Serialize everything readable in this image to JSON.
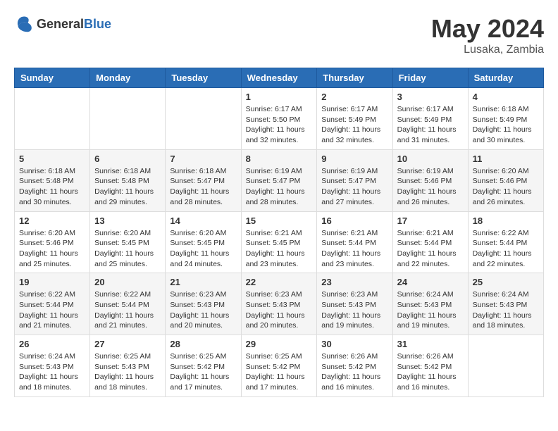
{
  "header": {
    "logo_general": "General",
    "logo_blue": "Blue",
    "title": "May 2024",
    "location": "Lusaka, Zambia"
  },
  "weekdays": [
    "Sunday",
    "Monday",
    "Tuesday",
    "Wednesday",
    "Thursday",
    "Friday",
    "Saturday"
  ],
  "weeks": [
    [
      {
        "day": "",
        "info": ""
      },
      {
        "day": "",
        "info": ""
      },
      {
        "day": "",
        "info": ""
      },
      {
        "day": "1",
        "info": "Sunrise: 6:17 AM\nSunset: 5:50 PM\nDaylight: 11 hours and 32 minutes."
      },
      {
        "day": "2",
        "info": "Sunrise: 6:17 AM\nSunset: 5:49 PM\nDaylight: 11 hours and 32 minutes."
      },
      {
        "day": "3",
        "info": "Sunrise: 6:17 AM\nSunset: 5:49 PM\nDaylight: 11 hours and 31 minutes."
      },
      {
        "day": "4",
        "info": "Sunrise: 6:18 AM\nSunset: 5:49 PM\nDaylight: 11 hours and 30 minutes."
      }
    ],
    [
      {
        "day": "5",
        "info": "Sunrise: 6:18 AM\nSunset: 5:48 PM\nDaylight: 11 hours and 30 minutes."
      },
      {
        "day": "6",
        "info": "Sunrise: 6:18 AM\nSunset: 5:48 PM\nDaylight: 11 hours and 29 minutes."
      },
      {
        "day": "7",
        "info": "Sunrise: 6:18 AM\nSunset: 5:47 PM\nDaylight: 11 hours and 28 minutes."
      },
      {
        "day": "8",
        "info": "Sunrise: 6:19 AM\nSunset: 5:47 PM\nDaylight: 11 hours and 28 minutes."
      },
      {
        "day": "9",
        "info": "Sunrise: 6:19 AM\nSunset: 5:47 PM\nDaylight: 11 hours and 27 minutes."
      },
      {
        "day": "10",
        "info": "Sunrise: 6:19 AM\nSunset: 5:46 PM\nDaylight: 11 hours and 26 minutes."
      },
      {
        "day": "11",
        "info": "Sunrise: 6:20 AM\nSunset: 5:46 PM\nDaylight: 11 hours and 26 minutes."
      }
    ],
    [
      {
        "day": "12",
        "info": "Sunrise: 6:20 AM\nSunset: 5:46 PM\nDaylight: 11 hours and 25 minutes."
      },
      {
        "day": "13",
        "info": "Sunrise: 6:20 AM\nSunset: 5:45 PM\nDaylight: 11 hours and 25 minutes."
      },
      {
        "day": "14",
        "info": "Sunrise: 6:20 AM\nSunset: 5:45 PM\nDaylight: 11 hours and 24 minutes."
      },
      {
        "day": "15",
        "info": "Sunrise: 6:21 AM\nSunset: 5:45 PM\nDaylight: 11 hours and 23 minutes."
      },
      {
        "day": "16",
        "info": "Sunrise: 6:21 AM\nSunset: 5:44 PM\nDaylight: 11 hours and 23 minutes."
      },
      {
        "day": "17",
        "info": "Sunrise: 6:21 AM\nSunset: 5:44 PM\nDaylight: 11 hours and 22 minutes."
      },
      {
        "day": "18",
        "info": "Sunrise: 6:22 AM\nSunset: 5:44 PM\nDaylight: 11 hours and 22 minutes."
      }
    ],
    [
      {
        "day": "19",
        "info": "Sunrise: 6:22 AM\nSunset: 5:44 PM\nDaylight: 11 hours and 21 minutes."
      },
      {
        "day": "20",
        "info": "Sunrise: 6:22 AM\nSunset: 5:44 PM\nDaylight: 11 hours and 21 minutes."
      },
      {
        "day": "21",
        "info": "Sunrise: 6:23 AM\nSunset: 5:43 PM\nDaylight: 11 hours and 20 minutes."
      },
      {
        "day": "22",
        "info": "Sunrise: 6:23 AM\nSunset: 5:43 PM\nDaylight: 11 hours and 20 minutes."
      },
      {
        "day": "23",
        "info": "Sunrise: 6:23 AM\nSunset: 5:43 PM\nDaylight: 11 hours and 19 minutes."
      },
      {
        "day": "24",
        "info": "Sunrise: 6:24 AM\nSunset: 5:43 PM\nDaylight: 11 hours and 19 minutes."
      },
      {
        "day": "25",
        "info": "Sunrise: 6:24 AM\nSunset: 5:43 PM\nDaylight: 11 hours and 18 minutes."
      }
    ],
    [
      {
        "day": "26",
        "info": "Sunrise: 6:24 AM\nSunset: 5:43 PM\nDaylight: 11 hours and 18 minutes."
      },
      {
        "day": "27",
        "info": "Sunrise: 6:25 AM\nSunset: 5:43 PM\nDaylight: 11 hours and 18 minutes."
      },
      {
        "day": "28",
        "info": "Sunrise: 6:25 AM\nSunset: 5:42 PM\nDaylight: 11 hours and 17 minutes."
      },
      {
        "day": "29",
        "info": "Sunrise: 6:25 AM\nSunset: 5:42 PM\nDaylight: 11 hours and 17 minutes."
      },
      {
        "day": "30",
        "info": "Sunrise: 6:26 AM\nSunset: 5:42 PM\nDaylight: 11 hours and 16 minutes."
      },
      {
        "day": "31",
        "info": "Sunrise: 6:26 AM\nSunset: 5:42 PM\nDaylight: 11 hours and 16 minutes."
      },
      {
        "day": "",
        "info": ""
      }
    ]
  ]
}
